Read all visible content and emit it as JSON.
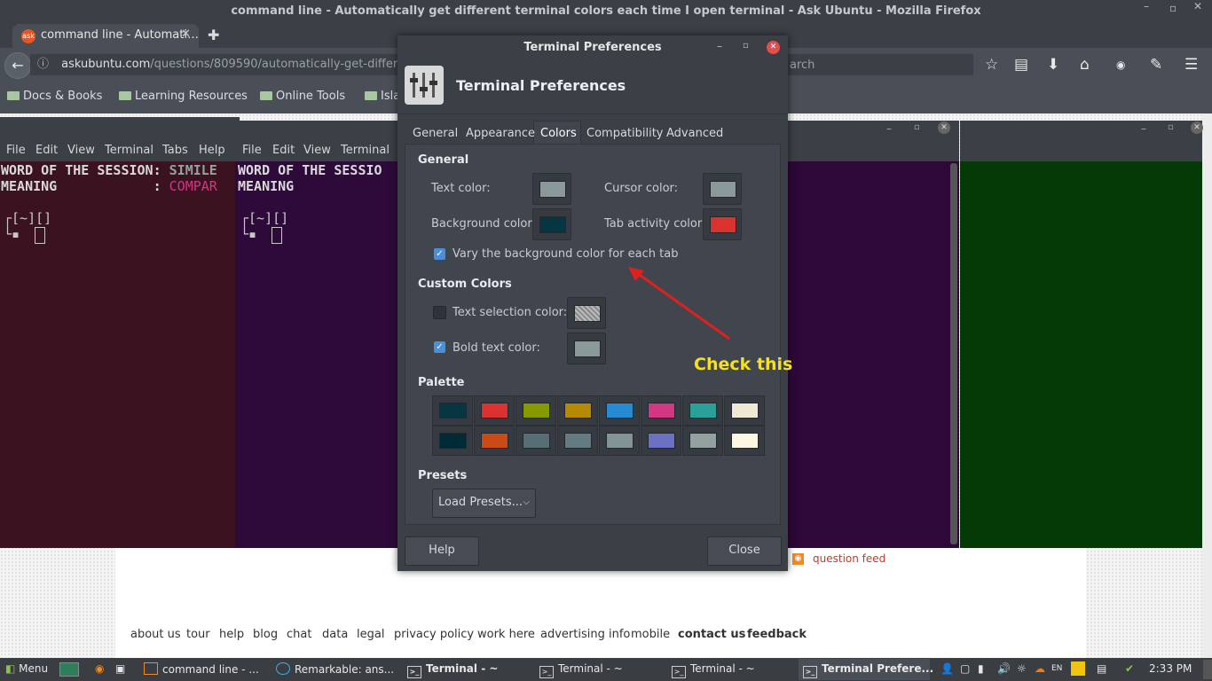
{
  "firefox": {
    "title": "command line - Automatically get different terminal colors each time I open terminal - Ask Ubuntu - Mozilla Firefox",
    "tab_title": "command line - Automati…",
    "tab_icon": "ask",
    "url_host": "askubuntu.com",
    "url_path": "/questions/809590/automatically-get-different-term",
    "search_placeholder": "arch",
    "bookmarks": [
      "Docs & Books",
      "Learning Resources",
      "Online Tools",
      "Isla"
    ]
  },
  "terminal1": {
    "menu": [
      "File",
      "Edit",
      "View",
      "Terminal",
      "Tabs",
      "Help"
    ],
    "line1_label": "WORD OF THE SESSION: ",
    "line1_value": "SIMILE",
    "line2_label": "MEANING            : ",
    "line2_value": "COMPAR",
    "prompt1": "┌[~][]",
    "prompt2": "└▪ ",
    "bg": "#3b1320"
  },
  "terminal2": {
    "menu": [
      "File",
      "Edit",
      "View",
      "Terminal"
    ],
    "line1_label": "WORD OF THE SESSIO",
    "line2_label": "MEANING",
    "prompt1": "┌[~][]",
    "prompt2": "└▪ ",
    "bg": "#2e0a3a"
  },
  "terminal3": {
    "bg": "#2d0838"
  },
  "terminal4": {
    "bg": "#033a06"
  },
  "dialog": {
    "title": "Terminal Preferences",
    "header": "Terminal Preferences",
    "tabs": [
      "General",
      "Appearance",
      "Colors",
      "Compatibility",
      "Advanced"
    ],
    "active_tab": "Colors",
    "general_header": "General",
    "text_color_label": "Text color:",
    "cursor_color_label": "Cursor color:",
    "background_color_label": "Background color:",
    "tab_activity_label": "Tab activity color:",
    "vary_bg_label": "Vary the background color for each tab",
    "vary_bg_checked": true,
    "custom_header": "Custom Colors",
    "text_selection_label": "Text selection color:",
    "text_selection_checked": false,
    "bold_text_label": "Bold text color:",
    "bold_text_checked": true,
    "palette_header": "Palette",
    "presets_header": "Presets",
    "load_presets": "Load Presets...",
    "help_button": "Help",
    "close_button": "Close",
    "colors": {
      "text": "#8a9a9a",
      "cursor": "#8a9a9a",
      "background": "#073642",
      "tab_activity": "#dc322f",
      "bold": "#8a9a9a"
    },
    "palette": [
      "#073642",
      "#dc322f",
      "#859900",
      "#b58900",
      "#268bd2",
      "#d33682",
      "#2aa198",
      "#eee8d5",
      "#002b36",
      "#cb4b16",
      "#586e75",
      "#657b83",
      "#839496",
      "#6c71c4",
      "#93a1a1",
      "#fdf6e3"
    ]
  },
  "annotation": {
    "text": "Check this",
    "color": "#f5e21b",
    "arrow_color": "#e02020"
  },
  "page": {
    "question_feed": "question feed",
    "footer_links": [
      "about us",
      "tour",
      "help",
      "blog",
      "chat",
      "data",
      "legal",
      "privacy policy",
      "work here",
      "advertising info",
      "mobile",
      "contact us",
      "feedback"
    ]
  },
  "taskbar": {
    "menu": "Menu",
    "items": [
      "command line - ...",
      "Remarkable: ans...",
      "Terminal - ~",
      "Terminal - ~",
      "Terminal - ~",
      "Terminal Prefere..."
    ],
    "clock": "2:33 PM"
  }
}
